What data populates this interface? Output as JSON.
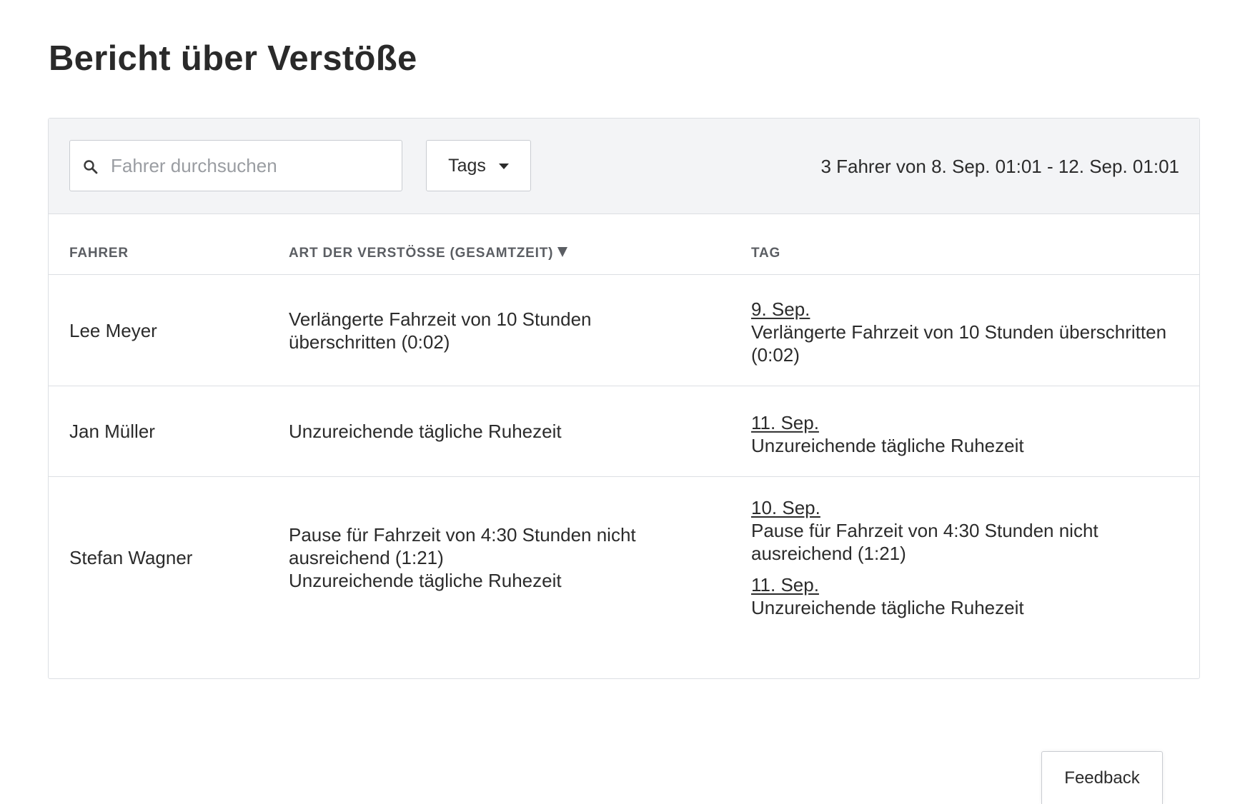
{
  "page": {
    "title": "Bericht über Verstöße"
  },
  "toolbar": {
    "search_placeholder": "Fahrer durchsuchen",
    "search_value": "",
    "tags_label": "Tags",
    "summary": "3 Fahrer von 8. Sep. 01:01 - 12. Sep. 01:01"
  },
  "table": {
    "headers": {
      "driver": "FAHRER",
      "violation_type": "ART DER VERSTÖSSE (GESAMTZEIT)",
      "day": "TAG"
    },
    "sort": {
      "column": "violation_type",
      "direction": "descending"
    },
    "rows": [
      {
        "driver": "Lee Meyer",
        "violations": [
          "Verlängerte Fahrzeit von 10 Stunden überschritten (0:02)"
        ],
        "days": [
          {
            "date": "9. Sep.",
            "text": "Verlängerte Fahrzeit von 10 Stunden überschritten (0:02)"
          }
        ]
      },
      {
        "driver": "Jan Müller",
        "violations": [
          "Unzureichende tägliche Ruhezeit"
        ],
        "days": [
          {
            "date": "11. Sep.",
            "text": "Unzureichende tägliche Ruhezeit"
          }
        ]
      },
      {
        "driver": "Stefan Wagner",
        "violations": [
          "Pause für Fahrzeit von 4:30 Stunden nicht ausreichend (1:21)",
          "Unzureichende tägliche Ruhezeit"
        ],
        "days": [
          {
            "date": "10. Sep.",
            "text": "Pause für Fahrzeit von 4:30 Stunden nicht ausreichend (1:21)"
          },
          {
            "date": "11. Sep.",
            "text": "Unzureichende tägliche Ruhezeit"
          }
        ]
      }
    ]
  },
  "feedback": {
    "label": "Feedback"
  },
  "icons": {
    "search": "search-icon",
    "tags_caret": "caret-down-icon",
    "sort": "sort-desc-icon"
  }
}
